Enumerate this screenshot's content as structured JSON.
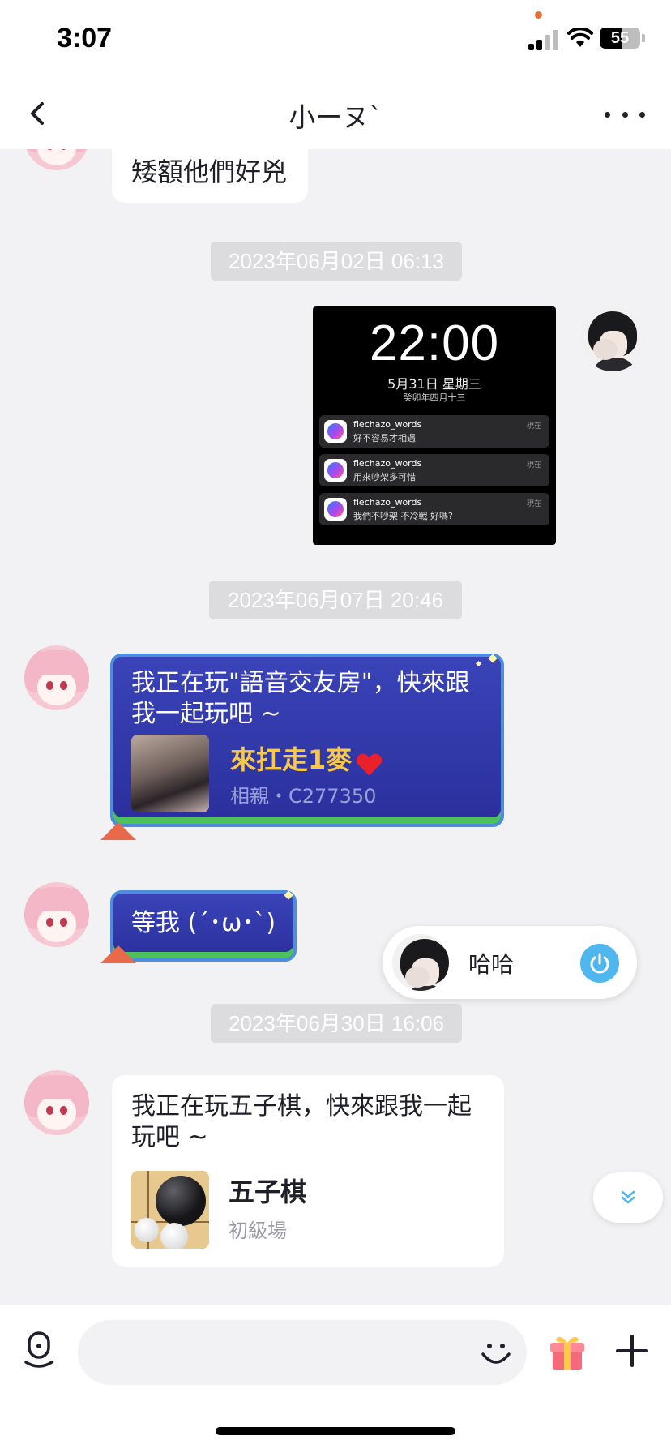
{
  "status_bar": {
    "time": "3:07",
    "battery_text": "55",
    "battery_level": 0.55
  },
  "nav": {
    "title": "小ーヌ`"
  },
  "messages": {
    "m1_text": "矮額他們好兇",
    "ts1": "2023年06月02日 06:13",
    "screenshot": {
      "clock": "22:00",
      "date": "5月31日 星期三",
      "lunar": "癸卯年四月十三",
      "notifications": [
        {
          "sender": "flechazo_words",
          "message": "好不容易才相遇",
          "when": "現在"
        },
        {
          "sender": "flechazo_words",
          "message": "用來吵架多可惜",
          "when": "現在"
        },
        {
          "sender": "flechazo_words",
          "message": "我們不吵架 不冷戰 好嗎?",
          "when": "現在"
        }
      ]
    },
    "ts2": "2023年06月07日 20:46",
    "invite_voice": {
      "text": "我正在玩\"語音交友房\"，快來跟我一起玩吧 ~",
      "room_title": "來扛走1麥",
      "room_sub": "相親・C277350"
    },
    "m4_text": "等我 (´･ω･`)",
    "ts3": "2023年06月30日 16:06",
    "invite_game": {
      "text": "我正在玩五子棋，快來跟我一起玩吧 ~",
      "game_title": "五子棋",
      "game_sub": "初級場"
    }
  },
  "voice_pill": {
    "label": "哈哈"
  },
  "input": {
    "placeholder": ""
  },
  "colors": {
    "background": "#f2f2f4",
    "bubble_blue": "#2a2f9c",
    "gold": "#f7c84a",
    "accent_blue": "#4fb6ee"
  },
  "icons": [
    "back-icon",
    "more-icon",
    "messenger-icon",
    "heart-icon",
    "power-icon",
    "chevron-double-down-icon",
    "microphone-icon",
    "smile-icon",
    "gift-icon",
    "plus-icon"
  ]
}
